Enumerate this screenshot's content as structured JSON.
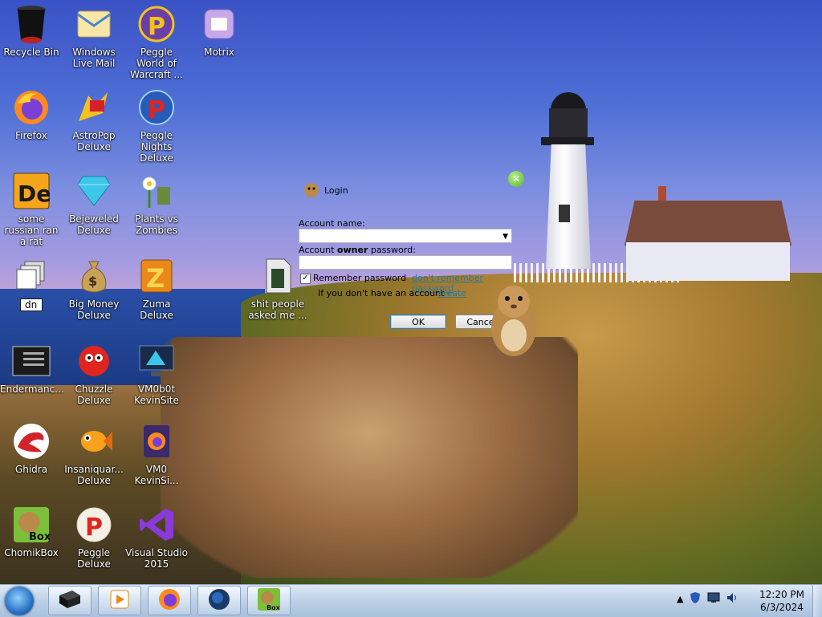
{
  "desktop": {
    "icons": [
      {
        "label": "Recycle Bin"
      },
      {
        "label": "Windows Live Mail"
      },
      {
        "label": "Peggle World of Warcraft ..."
      },
      {
        "label": "Motrix"
      },
      {
        "label": "Firefox"
      },
      {
        "label": "AstroPop Deluxe"
      },
      {
        "label": "Peggle Nights Deluxe"
      },
      {
        "label": "some russian ran a rat"
      },
      {
        "label": "Bejeweled Deluxe"
      },
      {
        "label": "Plants vs Zombies"
      },
      {
        "label": "dn"
      },
      {
        "label": "Big Money Deluxe"
      },
      {
        "label": "Zuma Deluxe"
      },
      {
        "label": "shit people asked me ..."
      },
      {
        "label": "Endermanc..."
      },
      {
        "label": "Chuzzle Deluxe"
      },
      {
        "label": "VM0b0t KevinSite"
      },
      {
        "label": "Ghidra"
      },
      {
        "label": "Insaniquar... Deluxe"
      },
      {
        "label": "VM0 KevinSi..."
      },
      {
        "label": "ChomikBox"
      },
      {
        "label": "Peggle Deluxe"
      },
      {
        "label": "Visual Studio 2015"
      }
    ]
  },
  "login": {
    "title": "Login",
    "account_name_label": "Account name:",
    "account_name_value": "",
    "password_label_pre": "Account ",
    "password_label_bold": "owner",
    "password_label_post": " password:",
    "remember_label": "Remember password",
    "remember_checked": "✓",
    "forgot_link": "don't remember password",
    "no_account_text": "If you don't have an account -",
    "create_link": "create",
    "ok_label": "OK",
    "cancel_label": "Cancel"
  },
  "taskbar": {
    "clock_time": "12:20 PM",
    "clock_date": "6/3/2024",
    "tray_arrow": "▲"
  }
}
